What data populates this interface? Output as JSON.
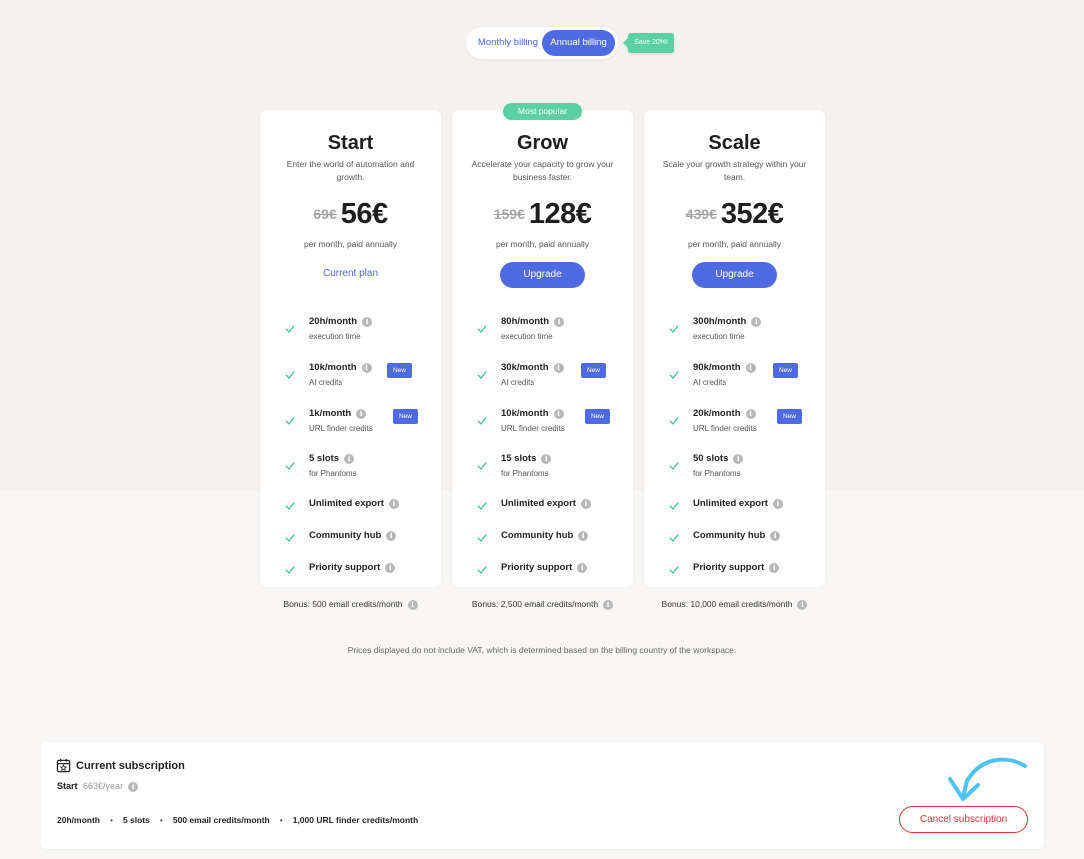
{
  "billing_toggle": {
    "monthly_label": "Monthly billing",
    "annual_label": "Annual billing",
    "selected": "Annual billing",
    "save_tag": "Save 20%!"
  },
  "popular_badge": "Most popular",
  "info_glyph": "i",
  "plans": [
    {
      "name": "Start",
      "description": "Enter the world of automation and growth.",
      "old_price": "69€",
      "price": "56€",
      "price_note": "per month, paid annually",
      "action_label": "Current plan",
      "features": [
        {
          "title": "20h/month",
          "sub": "execution time",
          "badge": ""
        },
        {
          "title": "10k/month",
          "sub": "AI credits",
          "badge": "New"
        },
        {
          "title": "1k/month",
          "sub": "URL finder credits",
          "badge": "New"
        },
        {
          "title": "5 slots",
          "sub": "for Phantoms",
          "badge": ""
        },
        {
          "title": "Unlimited export",
          "sub": "",
          "badge": ""
        },
        {
          "title": "Community hub",
          "sub": "",
          "badge": ""
        },
        {
          "title": "Priority support",
          "sub": "",
          "badge": ""
        }
      ],
      "bonus": "Bonus: 500 email credits/month"
    },
    {
      "name": "Grow",
      "description": "Accelerate your capacity to grow your business faster.",
      "old_price": "159€",
      "price": "128€",
      "price_note": "per month, paid annually",
      "action_label": "Upgrade",
      "features": [
        {
          "title": "80h/month",
          "sub": "execution time",
          "badge": ""
        },
        {
          "title": "30k/month",
          "sub": "AI credits",
          "badge": "New"
        },
        {
          "title": "10k/month",
          "sub": "URL finder credits",
          "badge": "New"
        },
        {
          "title": "15 slots",
          "sub": "for Phantoms",
          "badge": ""
        },
        {
          "title": "Unlimited export",
          "sub": "",
          "badge": ""
        },
        {
          "title": "Community hub",
          "sub": "",
          "badge": ""
        },
        {
          "title": "Priority support",
          "sub": "",
          "badge": ""
        }
      ],
      "bonus": "Bonus: 2,500 email credits/month"
    },
    {
      "name": "Scale",
      "description": "Scale your growth strategy within your team.",
      "old_price": "439€",
      "price": "352€",
      "price_note": "per month, paid annually",
      "action_label": "Upgrade",
      "features": [
        {
          "title": "300h/month",
          "sub": "execution time",
          "badge": ""
        },
        {
          "title": "90k/month",
          "sub": "AI credits",
          "badge": "New"
        },
        {
          "title": "20k/month",
          "sub": "URL finder credits",
          "badge": "New"
        },
        {
          "title": "50 slots",
          "sub": "for Phantoms",
          "badge": ""
        },
        {
          "title": "Unlimited export",
          "sub": "",
          "badge": ""
        },
        {
          "title": "Community hub",
          "sub": "",
          "badge": ""
        },
        {
          "title": "Priority support",
          "sub": "",
          "badge": ""
        }
      ],
      "bonus": "Bonus: 10,000 email credits/month"
    }
  ],
  "vat_note": "Prices displayed do not include VAT, which is determined based on the billing country of the workspace.",
  "subscription": {
    "title": "Current subscription",
    "plan_name": "Start",
    "plan_price": "663€/year",
    "features": [
      "20h/month",
      "5 slots",
      "500 email credits/month",
      "1,000 URL finder credits/month"
    ],
    "separator": "•",
    "cancel_label": "Cancel subscription"
  },
  "colors": {
    "accent": "#4f6be3",
    "success": "#5bd0a5",
    "danger": "#d63a3a",
    "annotation_arrow": "#4fc3f0"
  },
  "icons": {
    "feature_check": "check-icon",
    "info": "info-icon",
    "subscription": "calendar-star-icon"
  }
}
